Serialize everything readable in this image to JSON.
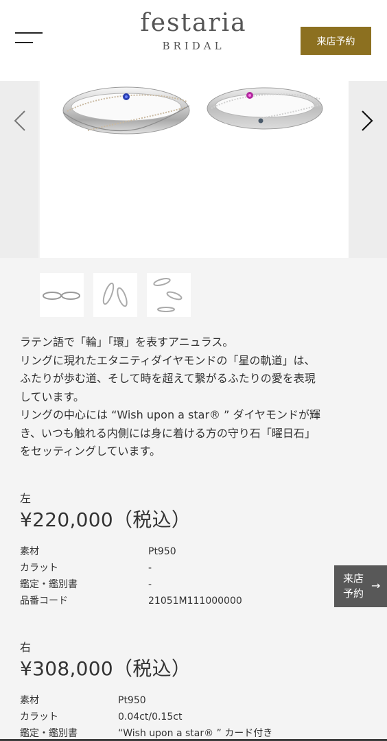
{
  "header": {
    "logo_main": "festaria",
    "logo_sub": "BRIDAL",
    "reserve_label": "来店予約"
  },
  "icons": {
    "menu": "hamburger-menu-icon",
    "prev": "chevron-left-icon",
    "next": "chevron-right-icon",
    "float_arrow": "arrow-right-icon"
  },
  "description": {
    "lines": [
      "ラテン語で「輪」「環」を表すアニュラス。",
      "リングに現れたエタニティダイヤモンドの「星の軌道」は、",
      "ふたりが歩む道、そして時を超えて繋がるふたりの愛を表現",
      "しています。",
      "リングの中心には “Wish upon a star® ” ダイヤモンドが輝",
      "き、いつも触れる内側には身に着ける方の守り石「曜日石」",
      "をセッティングしています。"
    ]
  },
  "left_ring": {
    "side_label": "左",
    "price": "¥220,000（税込）",
    "specs": [
      {
        "label": "素材",
        "value": "Pt950"
      },
      {
        "label": "カラット",
        "value": "-"
      },
      {
        "label": "鑑定・鑑別書",
        "value": "-"
      },
      {
        "label": "品番コード",
        "value": "21051M111000000"
      }
    ]
  },
  "right_ring": {
    "side_label": "右",
    "price": "¥308,000（税込）",
    "specs": [
      {
        "label": "素材",
        "value": "Pt950"
      },
      {
        "label": "カラット",
        "value": "0.04ct/0.15ct"
      },
      {
        "label": "鑑定・鑑別書",
        "value": "“Wish upon a star® ” カード付き"
      }
    ]
  },
  "float_reserve": {
    "line1": "来店",
    "line2": "予約",
    "arrow": "→"
  },
  "colors": {
    "accent": "#8c7020",
    "float_button": "#585858",
    "background": "#f4f4f4"
  }
}
